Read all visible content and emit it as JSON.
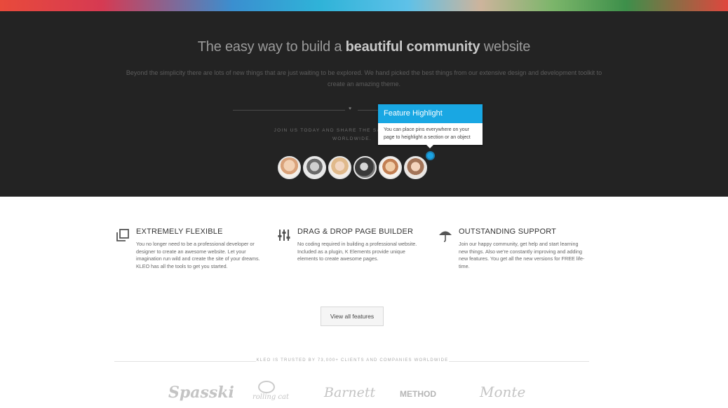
{
  "hero": {
    "headline_prefix": "The easy way to build a ",
    "headline_bold": "beautiful community",
    "headline_suffix": " website",
    "subtext": "Beyond the simplicity there are lots of new things that are just waiting to be explored. We hand picked the best things from our extensive design and development toolkit to create an amazing theme.",
    "join_text": "JOIN US TODAY AND SHARE THE SAME EXPERIENCE",
    "join_text_2": "WORLDWIDE."
  },
  "tooltip": {
    "title": "Feature Highlight",
    "body": "You can place pins everywhere on your page to heighlight a section or an object"
  },
  "features": [
    {
      "title": "EXTREMELY FLEXIBLE",
      "icon": "resize-squares-icon",
      "text": "You no longer need to be a professional developer or designer to create an awesome website. Let your imagination run wild and create the site of your dreams. KLEO has all the tools to get you started."
    },
    {
      "title": "DRAG & DROP PAGE BUILDER",
      "icon": "sliders-icon",
      "text": "No coding required in building a professional website. Included as a plugin, K Elements provide unique elements to create awesome pages."
    },
    {
      "title": "OUTSTANDING SUPPORT",
      "icon": "umbrella-icon",
      "text": "Join our happy community, get help and start learning new things. Also we're constantly improving and adding new features. You get all the new versions for FREE life-time."
    }
  ],
  "cta": {
    "label": "View all features"
  },
  "trusted": {
    "text": "KLEO IS TRUSTED BY 73,000+ CLIENTS AND COMPANIES WORLDWIDE"
  },
  "logos": [
    "Spasski",
    "rolling cat",
    "Barnett",
    "METHOD",
    "Monte"
  ],
  "colors": {
    "accent": "#19a7e3",
    "dark_bg": "#232323"
  }
}
